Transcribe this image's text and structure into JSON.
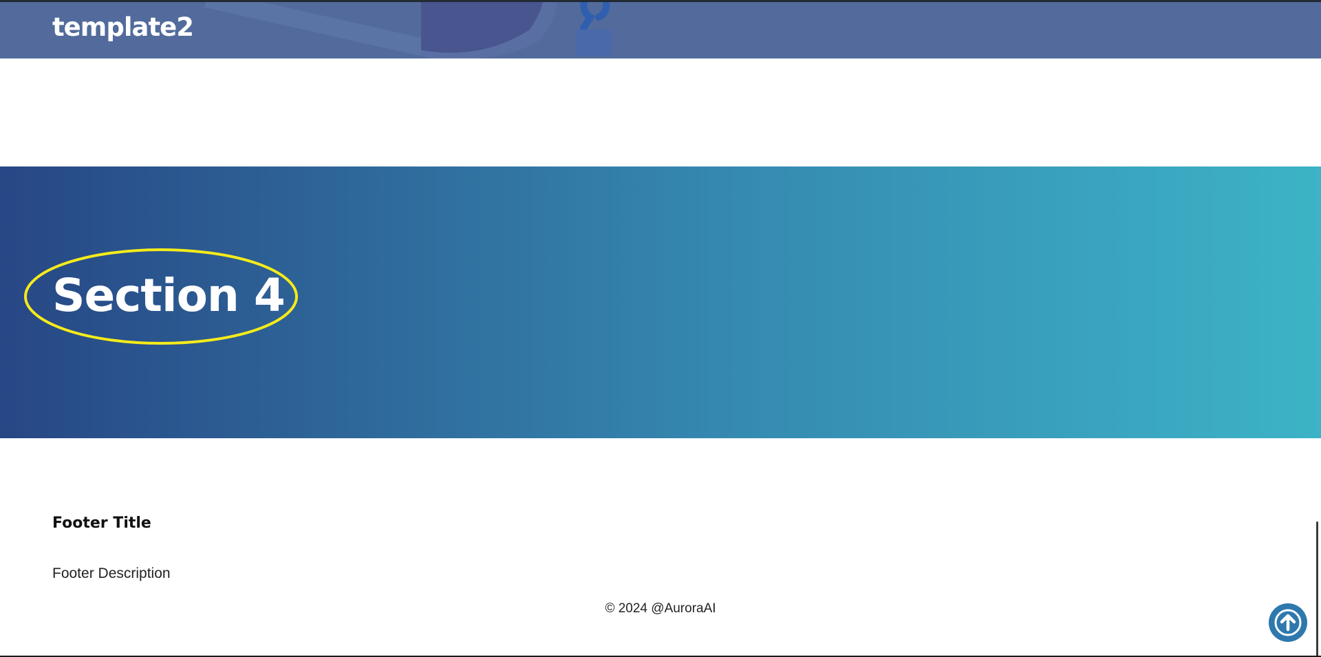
{
  "header": {
    "brand": "template2"
  },
  "section": {
    "title": "Section 4"
  },
  "footer": {
    "title": "Footer Title",
    "description": "Footer Description",
    "copyright": "© 2024 @AuroraAI"
  },
  "controls": {
    "scroll_top_icon": "arrow-up-icon"
  },
  "colors": {
    "header_bg": "#526b9c",
    "banner_gradient_start": "#274785",
    "banner_gradient_end": "#3cb3c6",
    "highlight": "#f5eb1a",
    "scroll_button": "#2e78ad"
  }
}
